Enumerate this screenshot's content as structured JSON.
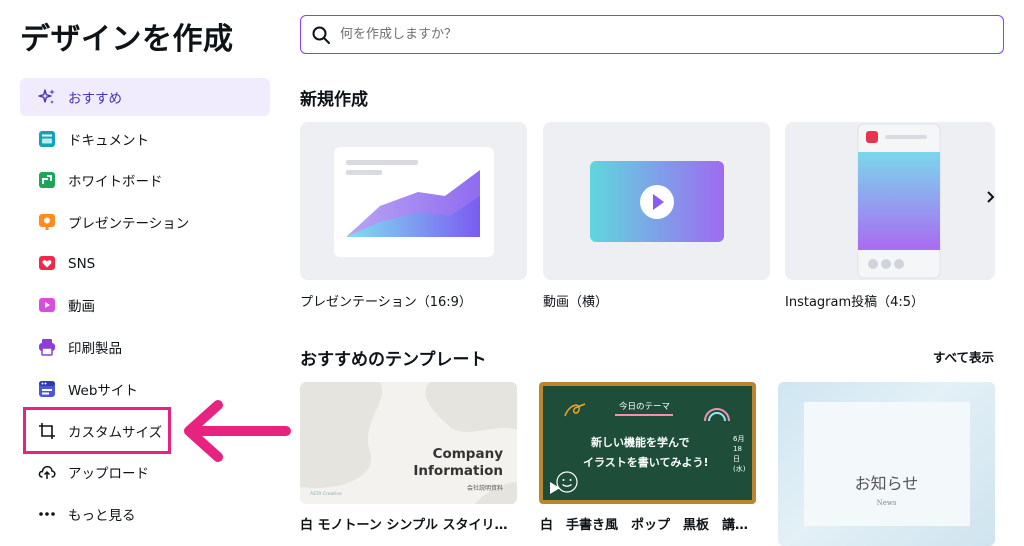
{
  "page": {
    "title": "デザインを作成"
  },
  "search": {
    "placeholder": "何を作成しますか？"
  },
  "sidebar": {
    "items": [
      {
        "label": "おすすめ",
        "icon": "sparkles-icon"
      },
      {
        "label": "ドキュメント",
        "icon": "document-icon"
      },
      {
        "label": "ホワイトボード",
        "icon": "whiteboard-icon"
      },
      {
        "label": "プレゼンテーション",
        "icon": "presentation-icon"
      },
      {
        "label": "SNS",
        "icon": "heart-icon"
      },
      {
        "label": "動画",
        "icon": "video-icon"
      },
      {
        "label": "印刷製品",
        "icon": "printer-icon"
      },
      {
        "label": "Webサイト",
        "icon": "website-icon"
      },
      {
        "label": "カスタムサイズ",
        "icon": "custom-size-icon"
      },
      {
        "label": "アップロード",
        "icon": "upload-cloud-icon"
      },
      {
        "label": "もっと見る",
        "icon": "more-dots-icon"
      }
    ]
  },
  "new_section": {
    "title": "新規作成",
    "cards": [
      {
        "label": "プレゼンテーション（16:9）"
      },
      {
        "label": "動画（横）"
      },
      {
        "label": "Instagram投稿（4:5）"
      }
    ]
  },
  "templates_section": {
    "title": "おすすめのテンプレート",
    "see_all": "すべて表示",
    "templates": [
      {
        "label": "白 モノトーン シンプル スタイリ…",
        "heading1": "Company",
        "heading2": "Information",
        "sub": "会社説明資料",
        "brand": "ASTA Creative"
      },
      {
        "label": "白　手書き風　ポップ　黒板　講…",
        "topic": "今日のテーマ",
        "line1": "新しい機能を学んで",
        "line2": "イラストを書いてみよう!",
        "date": "6月18日(水)"
      },
      {
        "label": "",
        "heading": "お知らせ",
        "sub": "News"
      }
    ]
  },
  "colors": {
    "accent": "#8b3dff",
    "highlight": "#e8237f",
    "active_bg": "#f1ecfd"
  }
}
